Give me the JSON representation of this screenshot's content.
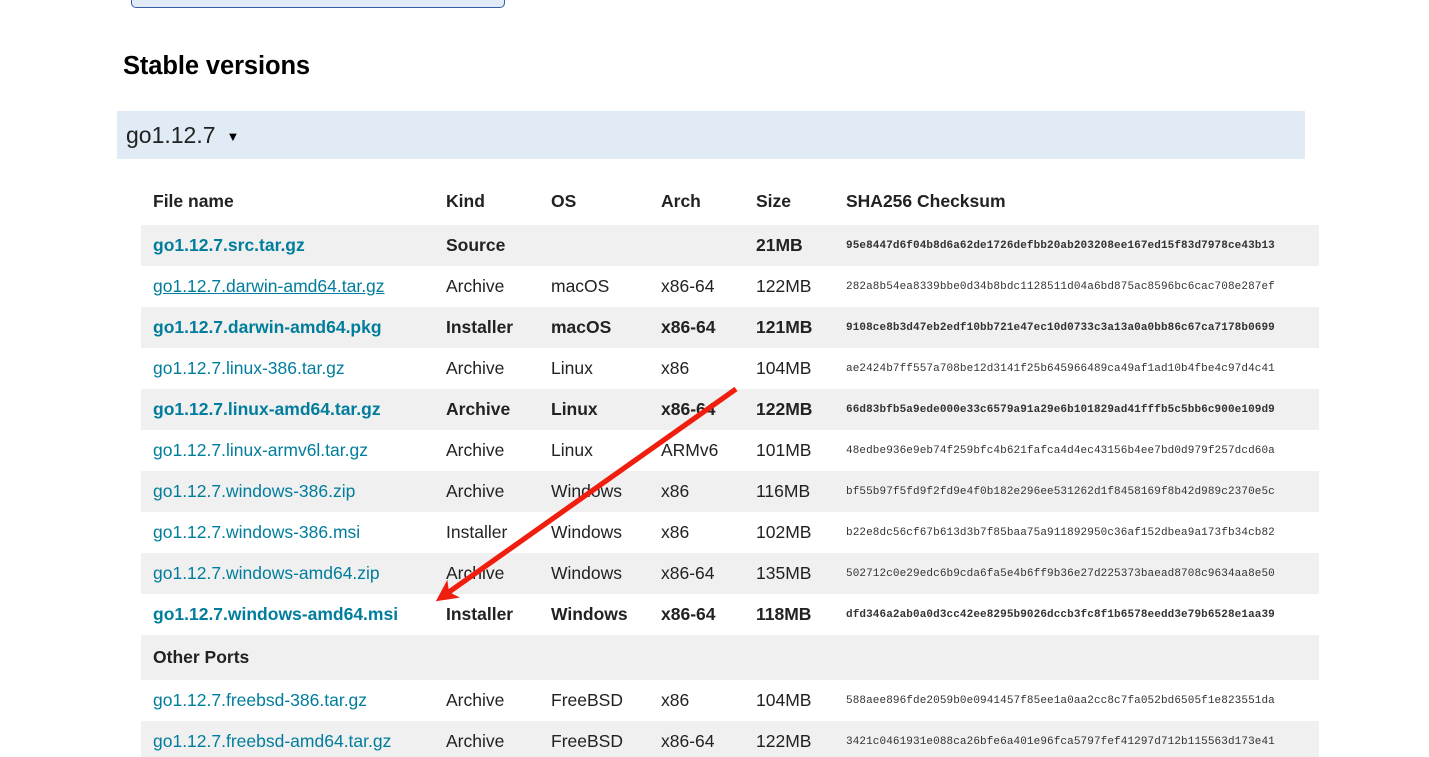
{
  "heading": "Stable versions",
  "version_selector": {
    "label": "go1.12.7",
    "caret": "▼"
  },
  "table": {
    "headers": {
      "file_name": "File name",
      "kind": "Kind",
      "os": "OS",
      "arch": "Arch",
      "size": "Size",
      "checksum": "SHA256 Checksum"
    },
    "rows": [
      {
        "file_name": "go1.12.7.src.tar.gz",
        "kind": "Source",
        "os": "",
        "arch": "",
        "size": "21MB",
        "checksum": "95e8447d6f04b8d6a62de1726defbb20ab203208ee167ed15f83d7978ce43b13"
      },
      {
        "file_name": "go1.12.7.darwin-amd64.tar.gz",
        "kind": "Archive",
        "os": "macOS",
        "arch": "x86-64",
        "size": "122MB",
        "checksum": "282a8b54ea8339bbe0d34b8bdc1128511d04a6bd875ac8596bc6cac708e287ef"
      },
      {
        "file_name": "go1.12.7.darwin-amd64.pkg",
        "kind": "Installer",
        "os": "macOS",
        "arch": "x86-64",
        "size": "121MB",
        "checksum": "9108ce8b3d47eb2edf10bb721e47ec10d0733c3a13a0a0bb86c67ca7178b0699"
      },
      {
        "file_name": "go1.12.7.linux-386.tar.gz",
        "kind": "Archive",
        "os": "Linux",
        "arch": "x86",
        "size": "104MB",
        "checksum": "ae2424b7ff557a708be12d3141f25b645966489ca49af1ad10b4fbe4c97d4c41"
      },
      {
        "file_name": "go1.12.7.linux-amd64.tar.gz",
        "kind": "Archive",
        "os": "Linux",
        "arch": "x86-64",
        "size": "122MB",
        "checksum": "66d83bfb5a9ede000e33c6579a91a29e6b101829ad41fffb5c5bb6c900e109d9"
      },
      {
        "file_name": "go1.12.7.linux-armv6l.tar.gz",
        "kind": "Archive",
        "os": "Linux",
        "arch": "ARMv6",
        "size": "101MB",
        "checksum": "48edbe936e9eb74f259bfc4b621fafca4d4ec43156b4ee7bd0d979f257dcd60a"
      },
      {
        "file_name": "go1.12.7.windows-386.zip",
        "kind": "Archive",
        "os": "Windows",
        "arch": "x86",
        "size": "116MB",
        "checksum": "bf55b97f5fd9f2fd9e4f0b182e296ee531262d1f8458169f8b42d989c2370e5c"
      },
      {
        "file_name": "go1.12.7.windows-386.msi",
        "kind": "Installer",
        "os": "Windows",
        "arch": "x86",
        "size": "102MB",
        "checksum": "b22e8dc56cf67b613d3b7f85baa75a911892950c36af152dbea9a173fb34cb82"
      },
      {
        "file_name": "go1.12.7.windows-amd64.zip",
        "kind": "Archive",
        "os": "Windows",
        "arch": "x86-64",
        "size": "135MB",
        "checksum": "502712c0e29edc6b9cda6fa5e4b6ff9b36e27d225373baead8708c9634aa8e50"
      },
      {
        "file_name": "go1.12.7.windows-amd64.msi",
        "kind": "Installer",
        "os": "Windows",
        "arch": "x86-64",
        "size": "118MB",
        "checksum": "dfd346a2ab0a0d3cc42ee8295b9026dccb3fc8f1b6578eedd3e79b6528e1aa39"
      }
    ],
    "other_ports_label": "Other Ports",
    "other_ports_rows": [
      {
        "file_name": "go1.12.7.freebsd-386.tar.gz",
        "kind": "Archive",
        "os": "FreeBSD",
        "arch": "x86",
        "size": "104MB",
        "checksum": "588aee896fde2059b0e0941457f85ee1a0aa2cc8c7fa052bd6505f1e823551da"
      },
      {
        "file_name": "go1.12.7.freebsd-amd64.tar.gz",
        "kind": "Archive",
        "os": "FreeBSD",
        "arch": "x86-64",
        "size": "122MB",
        "checksum": "3421c0461931e088ca26bfe6a401e96fca5797fef41297d712b115563d173e41"
      }
    ]
  },
  "annotation": {
    "arrow_color": "#f01e0e",
    "points_to": "go1.12.7.windows-amd64.msi"
  },
  "colors": {
    "link": "#007d9c",
    "version_bar_bg": "#e0ebf5",
    "stripe_bg": "#f0f0f0",
    "top_box_border": "#375eab"
  }
}
